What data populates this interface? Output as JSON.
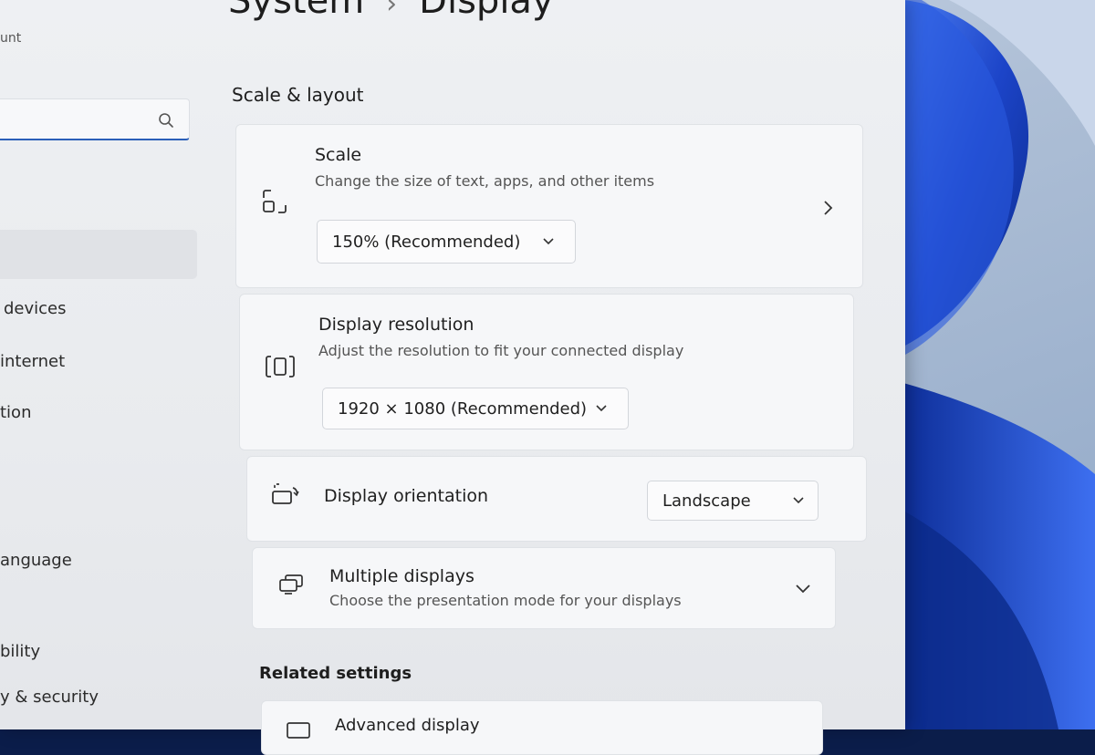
{
  "window": {
    "breadcrumb": {
      "parent": "System",
      "separator": "›",
      "current": "Display"
    }
  },
  "sidebar": {
    "account_fragment": "unt",
    "search": {
      "value": "",
      "placeholder": ""
    },
    "items": [
      {
        "label": "devices"
      },
      {
        "label": "internet"
      },
      {
        "label": "tion"
      },
      {
        "label": "anguage"
      },
      {
        "label": "bility"
      },
      {
        "label": "y & security"
      }
    ]
  },
  "main": {
    "scale_layout": {
      "title": "Scale & layout",
      "scale": {
        "title": "Scale",
        "description": "Change the size of text, apps, and other items",
        "selected": "150% (Recommended)"
      },
      "resolution": {
        "title": "Display resolution",
        "description": "Adjust the resolution to fit your connected display",
        "selected": "1920 × 1080 (Recommended)"
      },
      "orientation": {
        "title": "Display orientation",
        "selected": "Landscape"
      },
      "multiple": {
        "title": "Multiple displays",
        "description": "Choose the presentation mode for your displays"
      }
    },
    "related": {
      "title": "Related settings",
      "advanced": {
        "title": "Advanced display"
      }
    }
  },
  "colors": {
    "accent": "#2b5fb8",
    "wallpaper_blue": "#1f4fd1"
  },
  "icons": {
    "scale": "scale-icon",
    "resolution": "resolution-icon",
    "orientation": "orientation-icon",
    "multiple": "multiple-displays-icon",
    "search": "search-icon"
  }
}
